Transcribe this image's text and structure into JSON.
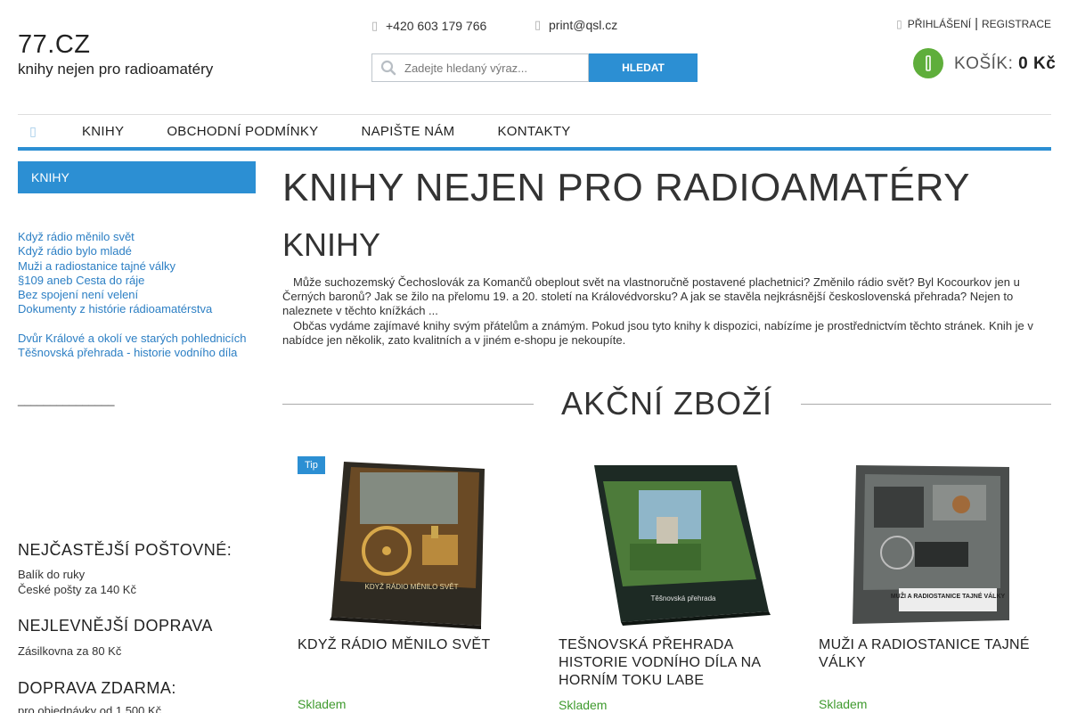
{
  "header": {
    "logo_title": "77.CZ",
    "logo_subtitle": "knihy nejen pro radioamatéry",
    "phone": "+420 603 179 766",
    "email": "print@qsl.cz",
    "login": "PŘIHLÁŠENÍ",
    "register": "REGISTRACE",
    "separator": "|",
    "cart_label": "KOŠÍK:",
    "cart_total": "0 Kč"
  },
  "search": {
    "placeholder": "Zadejte hledaný výraz...",
    "button": "HLEDAT"
  },
  "nav": {
    "items": [
      "KNIHY",
      "OBCHODNÍ PODMÍNKY",
      "NAPIŠTE NÁM",
      "KONTAKTY"
    ]
  },
  "sidebar": {
    "heading": "KNIHY",
    "links_group1": [
      "Když rádio měnilo svět",
      "Když rádio bylo mladé",
      "Muži a radiostanice tajné války",
      "§109 aneb Cesta do ráje",
      "Bez spojení není velení",
      "Dokumenty z histórie rádioamatérstva"
    ],
    "links_group2": [
      "Dvůr Králové a okolí ve starých pohlednicích",
      "Těšnovská přehrada - historie vodního díla"
    ],
    "separator": "_______________",
    "postage_heading": "NEJČASTĚJŠÍ POŠTOVNÉ:",
    "postage_line1": "Balík do ruky",
    "postage_line2": "České pošty za 140 Kč",
    "cheapest_heading": "NEJLEVNĚJŠÍ DOPRAVA",
    "cheapest_line": "Zásilkovna za 80 Kč",
    "free_heading": "DOPRAVA ZDARMA:",
    "free_line": "pro objednávky od 1 500 Kč"
  },
  "main": {
    "title": "KNIHY NEJEN PRO RADIOAMATÉRY",
    "subtitle": "KNIHY",
    "paragraph1": "Může suchozemský Čechoslovák za Komančů obeplout svět na vlastnoručně postavené plachetnici? Změnilo rádio svět? Byl Kocourkov jen u Černých baronů? Jak se žilo na přelomu 19. a 20. století na Královédvorsku? A jak se stavěla nejkrásnější československá přehrada? Nejen to naleznete v těchto knížkách ...",
    "paragraph2": "Občas vydáme zajímavé knihy svým přátelům a známým. Pokud jsou tyto knihy k dispozici, nabízíme je prostřednictvím těchto stránek. Knih je v nabídce jen několik, zato kvalitních a v jiném e-shopu je nekoupíte.",
    "akcni_title": "AKČNÍ ZBOŽÍ"
  },
  "products": [
    {
      "name": "KDYŽ RÁDIO MĚNILO SVĚT",
      "stock": "Skladem",
      "tag": "Tip",
      "cover_text": "KDYŽ RÁDIO MĚNILO SVĚT"
    },
    {
      "name": "TEŠNOVSKÁ PŘEHRADA HISTORIE VODNÍHO DÍLA NA HORNÍM TOKU LABE",
      "stock": "Skladem",
      "cover_text": "Těšnovská přehrada"
    },
    {
      "name": "MUŽI A RADIOSTANICE TAJNÉ VÁLKY",
      "stock": "Skladem",
      "cover_text": "MUŽI A RADIOSTANICE TAJNÉ VÁLKY"
    }
  ],
  "colors": {
    "accent": "#2c8fd3",
    "cart": "#5fae3b",
    "stock": "#3f9a2e"
  }
}
